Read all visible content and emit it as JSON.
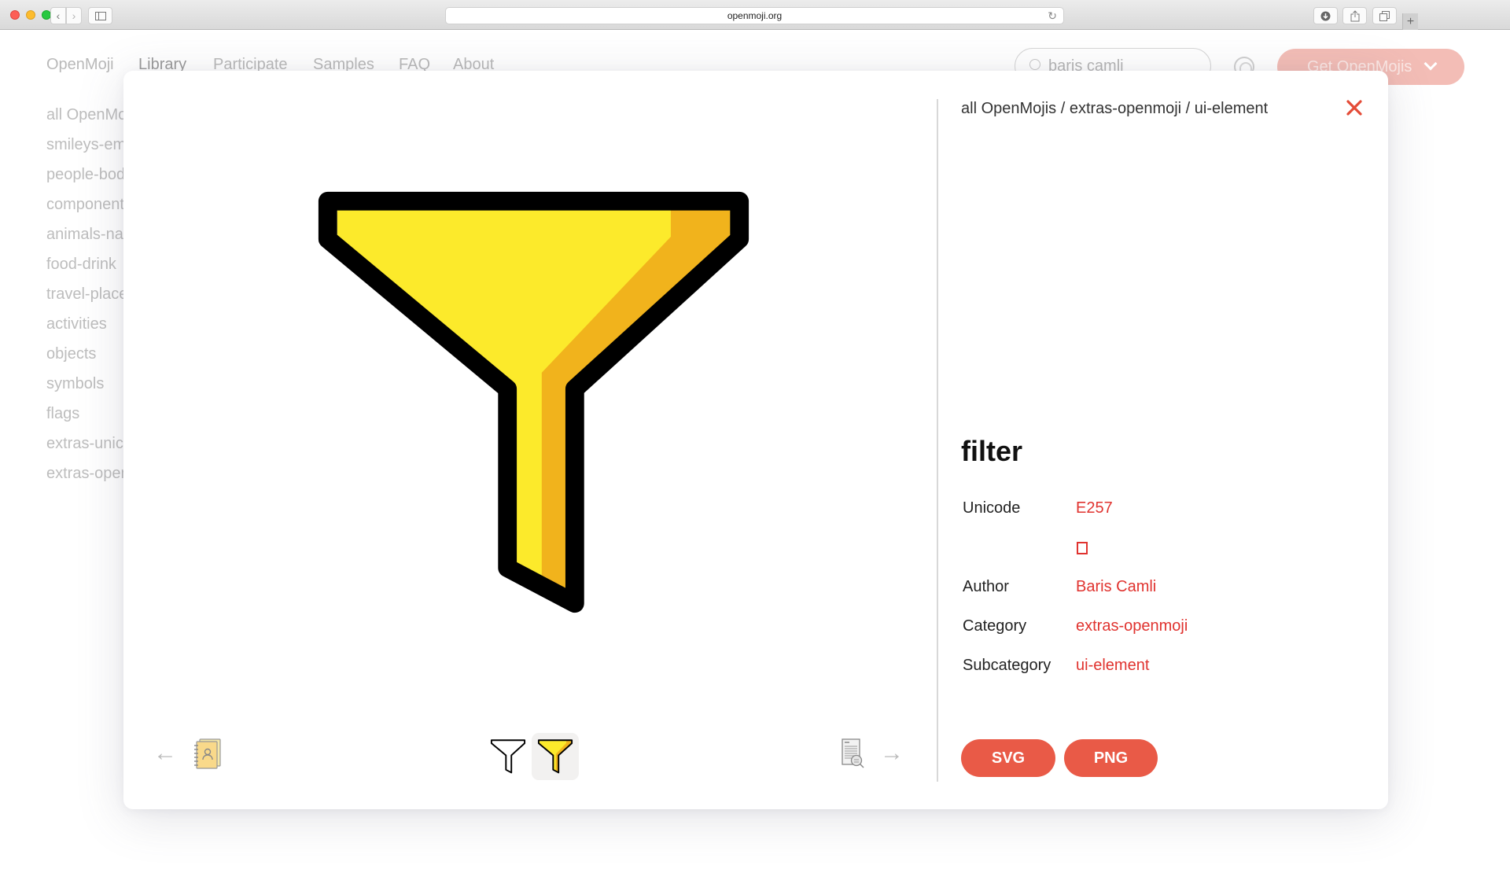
{
  "browser": {
    "url": "openmoji.org",
    "icons": {
      "back": "chevron-left-icon",
      "forward": "chevron-right-icon",
      "sidebar": "sidebar-icon",
      "reload": "reload-icon",
      "downloads": "download-icon",
      "share": "share-icon",
      "tabs": "tabs-icon",
      "new_tab": "+"
    }
  },
  "site": {
    "logo": "OpenMoji",
    "nav": [
      "Library",
      "Participate",
      "Samples",
      "FAQ",
      "About"
    ],
    "active_nav": "Library",
    "search": {
      "value": "baris camli",
      "placeholder": "Search"
    },
    "get_button": "Get OpenMojis",
    "categories": [
      "all OpenMojis",
      "smileys-emotion",
      "people-body",
      "component",
      "animals-nature",
      "food-drink",
      "travel-places",
      "activities",
      "objects",
      "symbols",
      "flags",
      "extras-unicode",
      "extras-openmoji"
    ]
  },
  "modal": {
    "breadcrumb": "all OpenMojis / extras-openmoji / ui-element",
    "title": "filter",
    "prev_arrow": "←",
    "next_arrow": "→",
    "prev_emoji": "address-book-icon",
    "next_emoji": "document-search-icon",
    "variants": [
      {
        "name": "black outline",
        "active": false
      },
      {
        "name": "color",
        "active": true
      }
    ],
    "details": [
      {
        "label": "Unicode",
        "value": "E257"
      },
      {
        "label": "",
        "value": "□"
      },
      {
        "label": "Author",
        "value": "Baris Camli"
      },
      {
        "label": "Category",
        "value": "extras-openmoji"
      },
      {
        "label": "Subcategory",
        "value": "ui-element"
      }
    ],
    "downloads": [
      "SVG",
      "PNG"
    ],
    "colors": {
      "accent": "#e95a47",
      "link": "#e0332f",
      "funnel_light": "#fcea2b",
      "funnel_shade": "#f1b31c",
      "outline": "#000000"
    }
  }
}
